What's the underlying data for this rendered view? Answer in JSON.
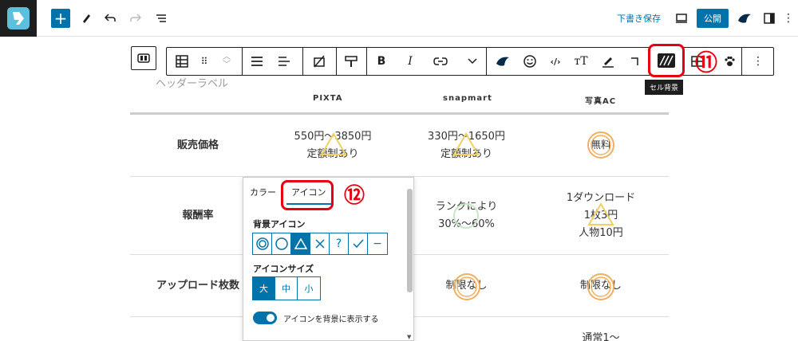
{
  "topbar": {
    "save_draft": "下書き保存",
    "publish": "公開",
    "add_label": "+"
  },
  "table": {
    "header_label": "ヘッダーラベル",
    "columns": [
      "PIXTA",
      "snapmart",
      "写真AC"
    ],
    "rows": [
      {
        "label": "販売価格",
        "cells": [
          "550円～3850円\n定額制あり",
          "330円～1650円\n定額制あり",
          "無料"
        ]
      },
      {
        "label": "報酬率",
        "cells": [
          "",
          "ランクにより\n30%～60%",
          "1ダウンロード\n1枚3円\n人物10円"
        ]
      },
      {
        "label": "アップロード枚数",
        "cells": [
          "",
          "制限なし",
          "制限なし"
        ]
      },
      {
        "label": "",
        "cells": [
          "",
          "",
          "通常1～"
        ]
      }
    ]
  },
  "block_toolbar": {
    "cell_background_tooltip": "セル背景",
    "callout_11": "⑪"
  },
  "popover": {
    "tabs": [
      "カラー",
      "アイコン"
    ],
    "active_tab": "アイコン",
    "callout_12": "⑫",
    "bg_icon_label": "背景アイコン",
    "bg_icons": [
      "◎",
      "○",
      "△",
      "×",
      "?",
      "✓",
      "−"
    ],
    "selected_bg_icon": "△",
    "icon_size_label": "アイコンサイズ",
    "sizes": [
      "大",
      "中",
      "小"
    ],
    "selected_size": "大",
    "toggle_label": "アイコンを背景に表示する",
    "toggle_on": true
  },
  "colors": {
    "accent": "#0073aa",
    "callout_red": "#e50012",
    "icon_yellow": "#f0d060",
    "icon_orange": "#f0b060"
  }
}
